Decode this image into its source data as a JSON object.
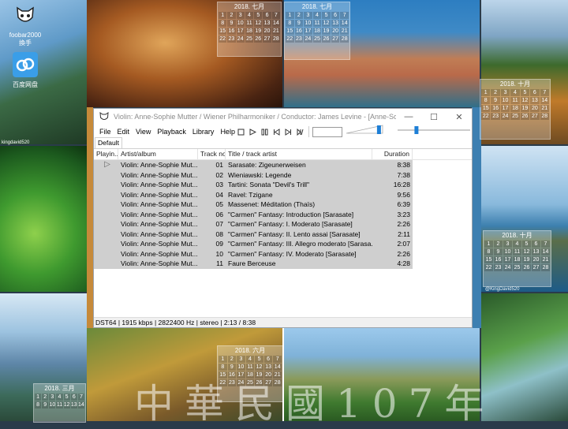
{
  "desktop": {
    "icons": [
      {
        "label": "foobar2000",
        "sublabel": "換手"
      },
      {
        "label": "百度网盘",
        "sublabel": ""
      }
    ],
    "calendars": [
      {
        "title": "2018. 七月"
      },
      {
        "title": "2018. 七月"
      },
      {
        "title": "2018. 十月"
      },
      {
        "title": "2018. 十月"
      },
      {
        "title": "2018. 三月"
      },
      {
        "title": "2018. 六月"
      }
    ],
    "captions": {
      "c1": "@KingDavid520",
      "c2": "kingdavid520"
    },
    "watermark": "中華民國107年"
  },
  "window": {
    "title": "Violin: Anne-Sophie Mutter / Wiener Philharmoniker / Conductor: James Levine - [Anne-Sophie Mutter...",
    "controls": {
      "minimize": "—",
      "maximize": "☐",
      "close": "✕"
    }
  },
  "menu": [
    "File",
    "Edit",
    "View",
    "Playback",
    "Library",
    "Help"
  ],
  "toolbar": {
    "icons": [
      "stop-icon",
      "play-icon",
      "pause-icon",
      "previous-icon",
      "next-icon",
      "random-icon"
    ]
  },
  "tabs": [
    "Default"
  ],
  "columns": [
    "Playin...",
    "Artist/album",
    "Track no",
    "Title / track artist",
    "Duration"
  ],
  "tracks": [
    {
      "playing": "▷",
      "artist": "Violin: Anne-Sophie Mut...",
      "no": "01",
      "title": "Sarasate: Zigeunerweisen",
      "duration": "8:38"
    },
    {
      "playing": "",
      "artist": "Violin: Anne-Sophie Mut...",
      "no": "02",
      "title": "Wieniawski: Legende",
      "duration": "7:38"
    },
    {
      "playing": "",
      "artist": "Violin: Anne-Sophie Mut...",
      "no": "03",
      "title": "Tartini: Sonata \"Devil's Trill\"",
      "duration": "16:28"
    },
    {
      "playing": "",
      "artist": "Violin: Anne-Sophie Mut...",
      "no": "04",
      "title": "Ravel: Tzigane",
      "duration": "9:56"
    },
    {
      "playing": "",
      "artist": "Violin: Anne-Sophie Mut...",
      "no": "05",
      "title": "Massenet: Méditation (Thaïs)",
      "duration": "6:39"
    },
    {
      "playing": "",
      "artist": "Violin: Anne-Sophie Mut...",
      "no": "06",
      "title": "\"Carmen\" Fantasy: Introduction [Sarasate]",
      "duration": "3:23"
    },
    {
      "playing": "",
      "artist": "Violin: Anne-Sophie Mut...",
      "no": "07",
      "title": "\"Carmen\" Fantasy: I. Moderato [Sarasate]",
      "duration": "2:26"
    },
    {
      "playing": "",
      "artist": "Violin: Anne-Sophie Mut...",
      "no": "08",
      "title": "\"Carmen\" Fantasy: II. Lento assai [Sarasate]",
      "duration": "2:11"
    },
    {
      "playing": "",
      "artist": "Violin: Anne-Sophie Mut...",
      "no": "09",
      "title": "\"Carmen\" Fantasy: III. Allegro moderato [Sarasa...",
      "duration": "2:07"
    },
    {
      "playing": "",
      "artist": "Violin: Anne-Sophie Mut...",
      "no": "10",
      "title": "\"Carmen\" Fantasy: IV. Moderato [Sarasate]",
      "duration": "2:26"
    },
    {
      "playing": "",
      "artist": "Violin: Anne-Sophie Mut...",
      "no": "11",
      "title": "Faure Berceuse",
      "duration": "4:28"
    }
  ],
  "status": "DST64 | 1915 kbps | 2822400 Hz | stereo | 2:13 / 8:38",
  "volume_level": 0.9,
  "seek_position": 0.26
}
